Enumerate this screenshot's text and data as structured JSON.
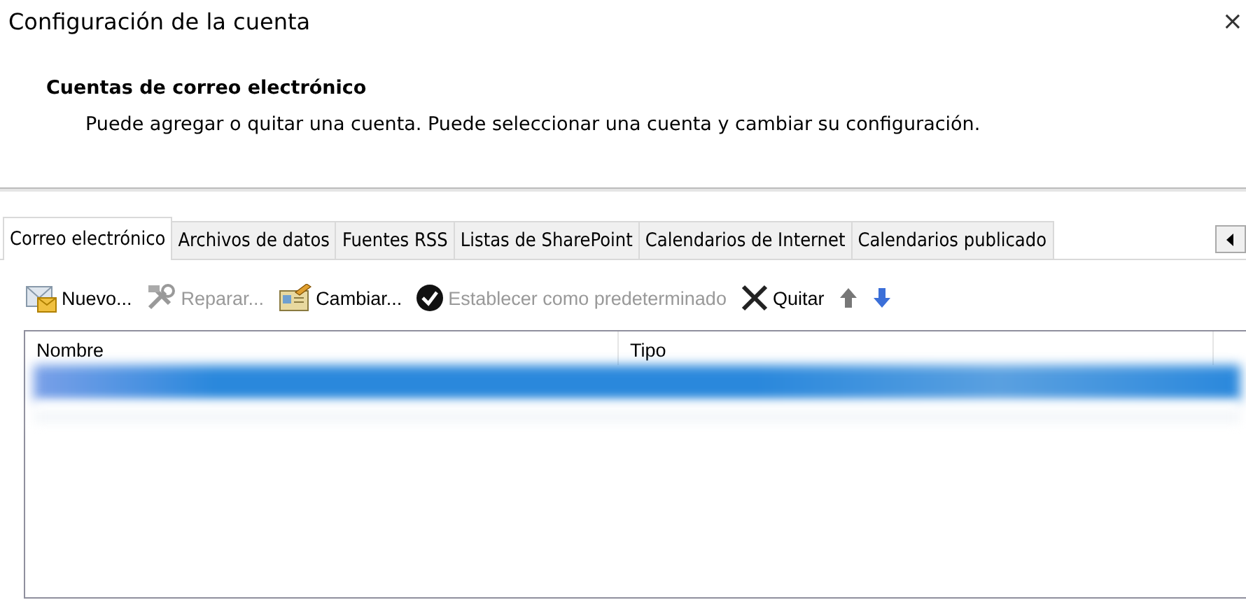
{
  "window": {
    "title": "Configuración de la cuenta",
    "close": "×"
  },
  "header": {
    "title": "Cuentas de correo electrónico",
    "description": "Puede agregar o quitar una cuenta. Puede seleccionar una cuenta y cambiar su configuración."
  },
  "tabs": [
    {
      "label": "Correo electrónico",
      "selected": true
    },
    {
      "label": "Archivos de datos",
      "selected": false
    },
    {
      "label": "Fuentes RSS",
      "selected": false
    },
    {
      "label": "Listas de SharePoint",
      "selected": false
    },
    {
      "label": "Calendarios de Internet",
      "selected": false
    },
    {
      "label": "Calendarios publicado",
      "selected": false
    }
  ],
  "toolbar": [
    {
      "kind": "new",
      "label": "Nuevo...",
      "disabled": false
    },
    {
      "kind": "repair",
      "label": "Reparar...",
      "disabled": true
    },
    {
      "kind": "change",
      "label": "Cambiar...",
      "disabled": false
    },
    {
      "kind": "default",
      "label": "Establecer como predeterminado",
      "disabled": true
    },
    {
      "kind": "remove",
      "label": "Quitar",
      "disabled": false
    },
    {
      "kind": "up",
      "disabled": true
    },
    {
      "kind": "down",
      "disabled": false
    }
  ],
  "table": {
    "columns": [
      "Nombre",
      "Tipo"
    ],
    "rows": [
      {
        "selected": true
      },
      {
        "selected": false
      }
    ]
  }
}
